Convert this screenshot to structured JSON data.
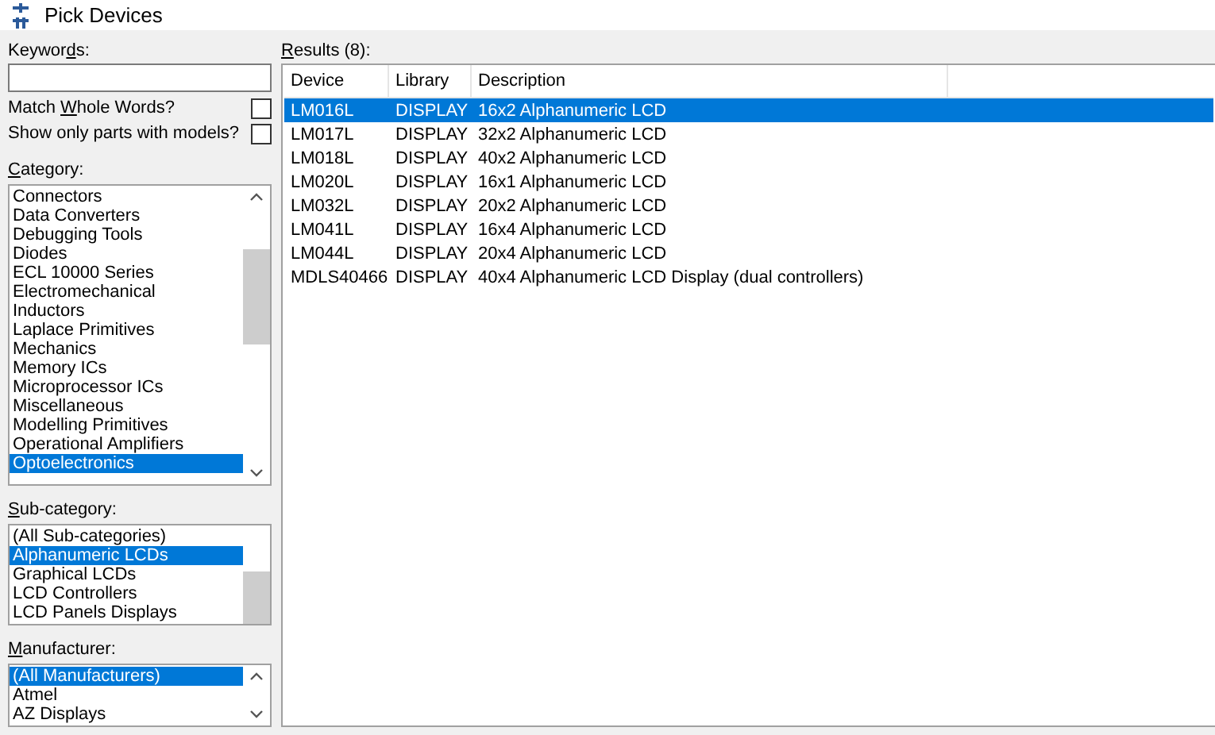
{
  "window": {
    "title": "Pick Devices"
  },
  "keywords": {
    "label": {
      "pre": "Keywor",
      "key": "d",
      "post": "s:"
    }
  },
  "options": [
    {
      "label": {
        "pre": "Match ",
        "key": "W",
        "post": "hole Words?"
      },
      "checked": false
    },
    {
      "label": {
        "pre": "Show only parts with models?"
      },
      "checked": false
    }
  ],
  "category": {
    "label": {
      "key": "C",
      "post": "ategory:"
    },
    "items": [
      {
        "label": "Connectors",
        "selected": false
      },
      {
        "label": "Data Converters",
        "selected": false
      },
      {
        "label": "Debugging Tools",
        "selected": false
      },
      {
        "label": "Diodes",
        "selected": false
      },
      {
        "label": "ECL 10000 Series",
        "selected": false
      },
      {
        "label": "Electromechanical",
        "selected": false
      },
      {
        "label": "Inductors",
        "selected": false
      },
      {
        "label": "Laplace Primitives",
        "selected": false
      },
      {
        "label": "Mechanics",
        "selected": false
      },
      {
        "label": "Memory ICs",
        "selected": false
      },
      {
        "label": "Microprocessor ICs",
        "selected": false
      },
      {
        "label": "Miscellaneous",
        "selected": false
      },
      {
        "label": "Modelling Primitives",
        "selected": false
      },
      {
        "label": "Operational Amplifiers",
        "selected": false
      },
      {
        "label": "Optoelectronics",
        "selected": true
      }
    ]
  },
  "subcategory": {
    "label": {
      "key": "S",
      "post": "ub-category:"
    },
    "items": [
      {
        "label": "(All Sub-categories)",
        "selected": false
      },
      {
        "label": "Alphanumeric LCDs",
        "selected": true
      },
      {
        "label": "Graphical LCDs",
        "selected": false
      },
      {
        "label": "LCD Controllers",
        "selected": false
      },
      {
        "label": "LCD Panels Displays",
        "selected": false
      }
    ]
  },
  "manufacturer": {
    "label": {
      "key": "M",
      "post": "anufacturer:"
    },
    "items": [
      {
        "label": "(All Manufacturers)",
        "selected": true
      },
      {
        "label": "Atmel",
        "selected": false
      },
      {
        "label": "AZ Displays",
        "selected": false
      }
    ]
  },
  "results": {
    "label": {
      "key": "R",
      "post": "esults (8):"
    },
    "columns": [
      "Device",
      "Library",
      "Description"
    ],
    "rows": [
      {
        "cells": [
          "LM016L",
          "DISPLAY",
          "16x2 Alphanumeric LCD"
        ],
        "selected": true
      },
      {
        "cells": [
          "LM017L",
          "DISPLAY",
          "32x2 Alphanumeric LCD"
        ],
        "selected": false
      },
      {
        "cells": [
          "LM018L",
          "DISPLAY",
          "40x2 Alphanumeric LCD"
        ],
        "selected": false
      },
      {
        "cells": [
          "LM020L",
          "DISPLAY",
          "16x1 Alphanumeric LCD"
        ],
        "selected": false
      },
      {
        "cells": [
          "LM032L",
          "DISPLAY",
          "20x2 Alphanumeric LCD"
        ],
        "selected": false
      },
      {
        "cells": [
          "LM041L",
          "DISPLAY",
          "16x4 Alphanumeric LCD"
        ],
        "selected": false
      },
      {
        "cells": [
          "LM044L",
          "DISPLAY",
          "20x4 Alphanumeric LCD"
        ],
        "selected": false
      },
      {
        "cells": [
          "MDLS40466",
          "DISPLAY",
          "40x4 Alphanumeric LCD Display (dual controllers)"
        ],
        "selected": false
      }
    ]
  }
}
